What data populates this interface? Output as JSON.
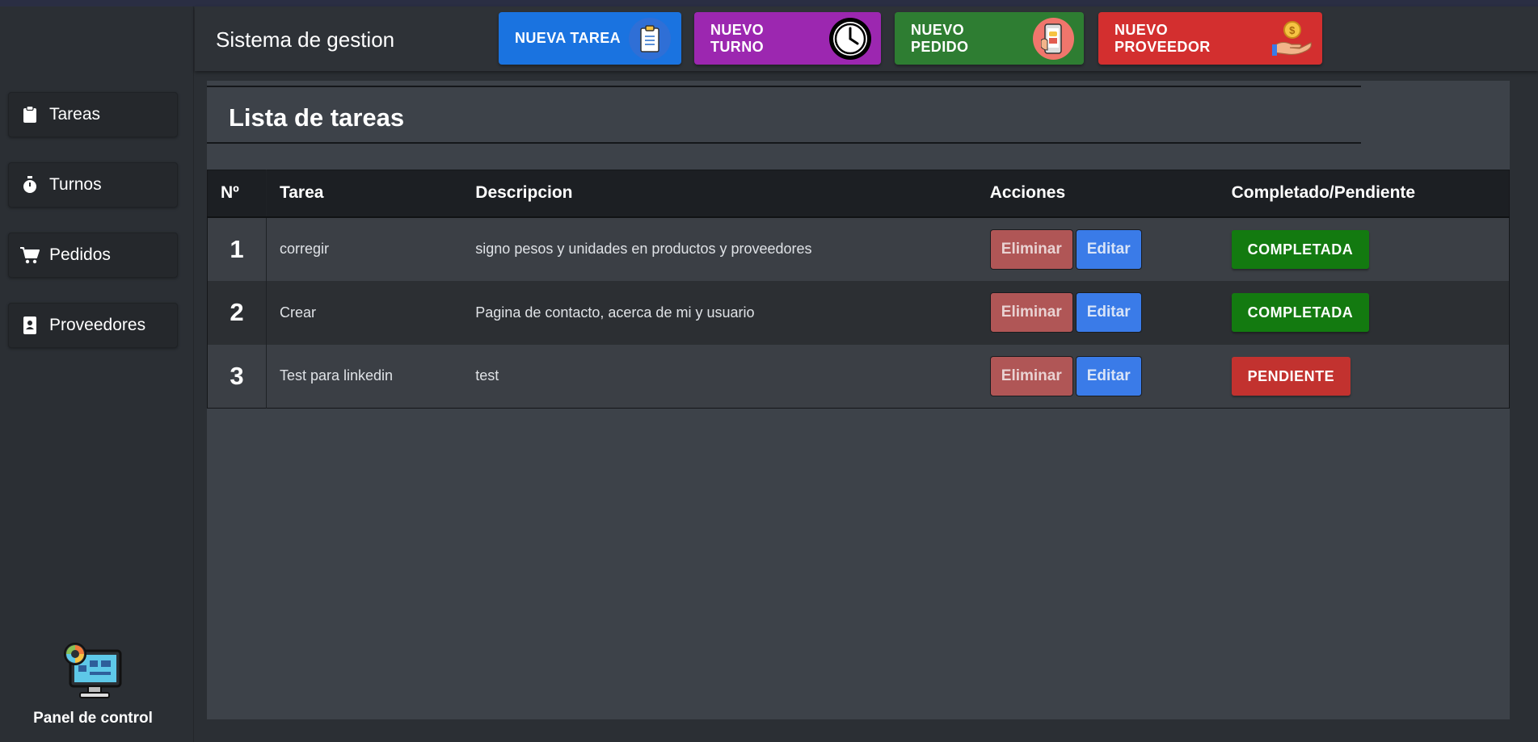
{
  "header": {
    "brand": "Sistema de gestion",
    "buttons": [
      {
        "label": "NUEVA TAREA",
        "color": "#1a73e0",
        "icon": "clipboard-icon"
      },
      {
        "label": "NUEVO TURNO",
        "color": "#9c27b0",
        "icon": "clock-icon"
      },
      {
        "label": "NUEVO PEDIDO",
        "color": "#2e7d32",
        "icon": "phone-order-icon"
      },
      {
        "label": "NUEVO PROVEEDOR",
        "color": "#d32f2f",
        "icon": "hand-coin-icon"
      }
    ]
  },
  "sidebar": {
    "items": [
      {
        "label": "Tareas",
        "icon": "clipboard-icon"
      },
      {
        "label": "Turnos",
        "icon": "stopwatch-icon"
      },
      {
        "label": "Pedidos",
        "icon": "cart-icon"
      },
      {
        "label": "Proveedores",
        "icon": "contact-book-icon"
      }
    ],
    "panel_label": "Panel de control"
  },
  "main": {
    "title": "Lista de tareas",
    "table": {
      "columns": [
        "Nº",
        "Tarea",
        "Descripcion",
        "Acciones",
        "Completado/Pendiente"
      ],
      "delete_label": "Eliminar",
      "edit_label": "Editar",
      "rows": [
        {
          "num": "1",
          "task": "corregir",
          "description": "signo pesos y unidades en productos y proveedores",
          "status": "COMPLETADA"
        },
        {
          "num": "2",
          "task": "Crear",
          "description": "Pagina de contacto, acerca de mi y usuario",
          "status": "COMPLETADA"
        },
        {
          "num": "3",
          "task": "Test para linkedin",
          "description": "test",
          "status": "PENDIENTE"
        }
      ]
    }
  }
}
